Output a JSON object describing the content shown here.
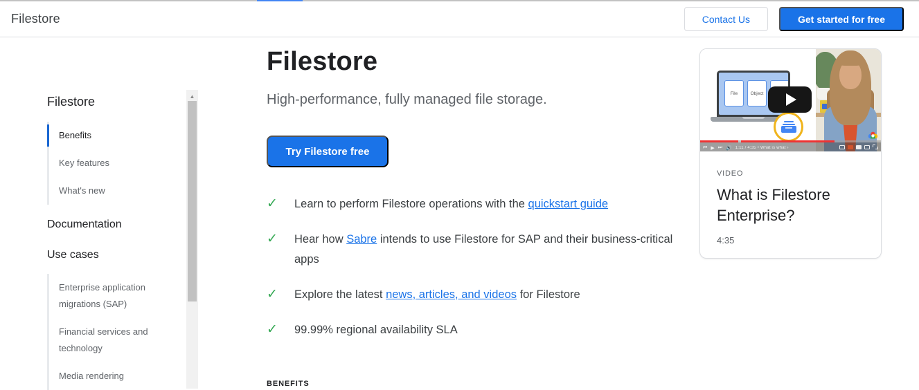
{
  "top_tab_bar": {
    "accent_color": "#4285f4"
  },
  "header": {
    "product_name": "Filestore",
    "contact_button": "Contact Us",
    "cta_button": "Get started for free"
  },
  "sidebar": {
    "sections": [
      {
        "type": "heading",
        "label": "Filestore",
        "level": 1
      },
      {
        "type": "group",
        "items": [
          {
            "label": "Benefits",
            "active": true
          },
          {
            "label": "Key features",
            "active": false
          },
          {
            "label": "What's new",
            "active": false
          }
        ]
      },
      {
        "type": "heading",
        "label": "Documentation",
        "level": 2
      },
      {
        "type": "heading",
        "label": "Use cases",
        "level": 2
      },
      {
        "type": "group",
        "items": [
          {
            "label": "Enterprise application migrations (SAP)",
            "active": false
          },
          {
            "label": "Financial services and technology",
            "active": false
          },
          {
            "label": "Media rendering",
            "active": false
          }
        ]
      }
    ]
  },
  "main": {
    "title": "Filestore",
    "subtitle": "High-performance, fully managed file storage.",
    "cta_button": "Try Filestore free",
    "checklist": [
      {
        "segments": [
          {
            "text": "Learn to perform Filestore operations with the "
          },
          {
            "text": "quickstart guide",
            "link": true
          }
        ]
      },
      {
        "segments": [
          {
            "text": "Hear how "
          },
          {
            "text": "Sabre",
            "link": true
          },
          {
            "text": " intends to use Filestore for SAP and their business-critical apps"
          }
        ]
      },
      {
        "segments": [
          {
            "text": "Explore the latest "
          },
          {
            "text": "news, articles, and videos",
            "link": true
          },
          {
            "text": " for Filestore"
          }
        ]
      },
      {
        "segments": [
          {
            "text": "99.99% regional availability SLA"
          }
        ]
      }
    ],
    "section_label": "BENEFITS"
  },
  "video_card": {
    "kicker": "VIDEO",
    "title": "What is Filestore Enterprise?",
    "duration": "4:35",
    "player": {
      "time_text": "1:11 / 4:35 • What is what ›",
      "screen_cards": [
        "File",
        "Object"
      ]
    }
  },
  "icons": {
    "check": "✓",
    "scroll_up_arrow": "▲",
    "prev": "⏮",
    "play": "▶",
    "next": "⏭",
    "volume": "🔊"
  },
  "colors": {
    "accent_blue": "#1a73e8",
    "link_blue": "#1a73e8",
    "check_green": "#34a853",
    "text_primary": "#202124",
    "text_secondary": "#5f6368",
    "border": "#dadce0",
    "progress_red": "#ee3333",
    "gold": "#f0b41c"
  }
}
